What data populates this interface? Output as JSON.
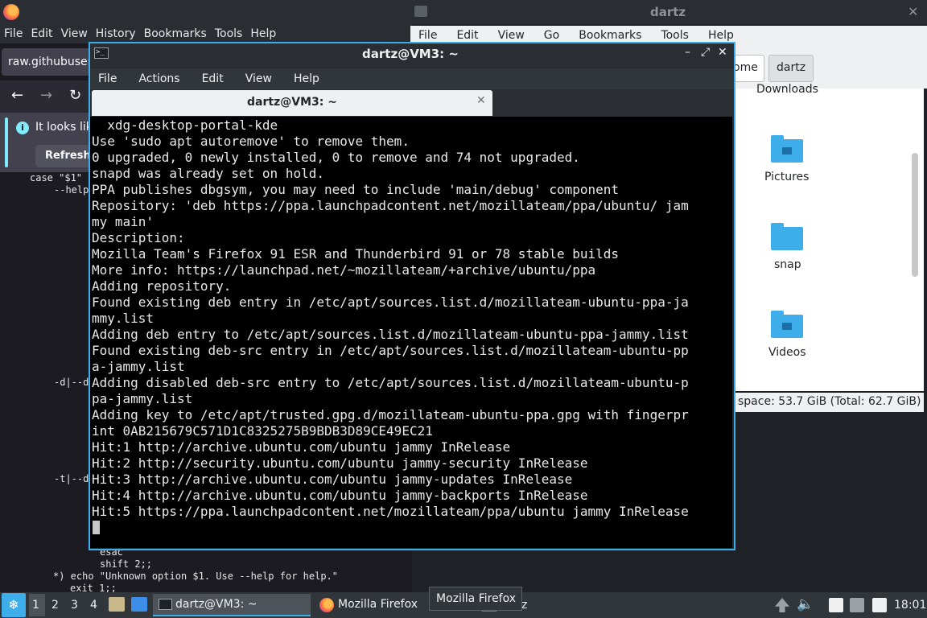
{
  "firefox": {
    "menu": [
      "File",
      "Edit",
      "View",
      "History",
      "Bookmarks",
      "Tools",
      "Help"
    ],
    "tab_title": "raw.githubuser",
    "notice_text": "It looks lik",
    "refresh_label": "Refresh",
    "code_lines": [
      "case \"$1\"",
      "--help",
      "-d|--d",
      "-t|--d",
      "esac",
      "shift 2;;",
      "*) echo \"Unknown option $1. Use --help for help.\"",
      "exit 1;;"
    ]
  },
  "file_manager": {
    "title": "dartz",
    "menu": [
      "File",
      "Edit",
      "View",
      "Go",
      "Bookmarks",
      "Tools",
      "Help"
    ],
    "breadcrumbs": [
      "ome",
      "dartz"
    ],
    "items": [
      {
        "label": "Downloads",
        "icon": "folder-download-icon"
      },
      {
        "label": "Pictures",
        "icon": "folder-pictures-icon"
      },
      {
        "label": "snap",
        "icon": "folder-icon"
      },
      {
        "label": "Videos",
        "icon": "folder-videos-icon"
      }
    ],
    "status": "space: 53.7 GiB (Total: 62.7 GiB)"
  },
  "terminal": {
    "title": "dartz@VM3: ~",
    "menu": [
      "File",
      "Actions",
      "Edit",
      "View",
      "Help"
    ],
    "tab_label": "dartz@VM3: ~",
    "lines": [
      "  xdg-desktop-portal-kde",
      "Use 'sudo apt autoremove' to remove them.",
      "0 upgraded, 0 newly installed, 0 to remove and 74 not upgraded.",
      "snapd was already set on hold.",
      "PPA publishes dbgsym, you may need to include 'main/debug' component",
      "Repository: 'deb https://ppa.launchpadcontent.net/mozillateam/ppa/ubuntu/ jam",
      "my main'",
      "Description:",
      "Mozilla Team's Firefox 91 ESR and Thunderbird 91 or 78 stable builds",
      "More info: https://launchpad.net/~mozillateam/+archive/ubuntu/ppa",
      "Adding repository.",
      "Found existing deb entry in /etc/apt/sources.list.d/mozillateam-ubuntu-ppa-ja",
      "mmy.list",
      "Adding deb entry to /etc/apt/sources.list.d/mozillateam-ubuntu-ppa-jammy.list",
      "Found existing deb-src entry in /etc/apt/sources.list.d/mozillateam-ubuntu-pp",
      "a-jammy.list",
      "Adding disabled deb-src entry to /etc/apt/sources.list.d/mozillateam-ubuntu-p",
      "pa-jammy.list",
      "Adding key to /etc/apt/trusted.gpg.d/mozillateam-ubuntu-ppa.gpg with fingerpr",
      "int 0AB215679C571D1C8325275B9BDB3D89CE49EC21",
      "Hit:1 http://archive.ubuntu.com/ubuntu jammy InRelease",
      "Hit:2 http://security.ubuntu.com/ubuntu jammy-security InRelease",
      "Hit:3 http://archive.ubuntu.com/ubuntu jammy-updates InRelease",
      "Hit:4 http://archive.ubuntu.com/ubuntu jammy-backports InRelease",
      "Hit:5 https://ppa.launchpadcontent.net/mozillateam/ppa/ubuntu jammy InRelease"
    ]
  },
  "taskbar": {
    "workspaces": [
      "1",
      "2",
      "3",
      "4"
    ],
    "tasks": [
      {
        "label": "dartz@VM3: ~",
        "icon": "terminal-icon"
      },
      {
        "label": "Mozilla Firefox",
        "icon": "firefox-icon"
      }
    ],
    "tooltip": "Mozilla Firefox",
    "partial_task": "z",
    "clock": "18:01"
  },
  "colors": {
    "accent": "#3daee9",
    "terminal_bg": "#000000",
    "panel": "#31363b"
  }
}
